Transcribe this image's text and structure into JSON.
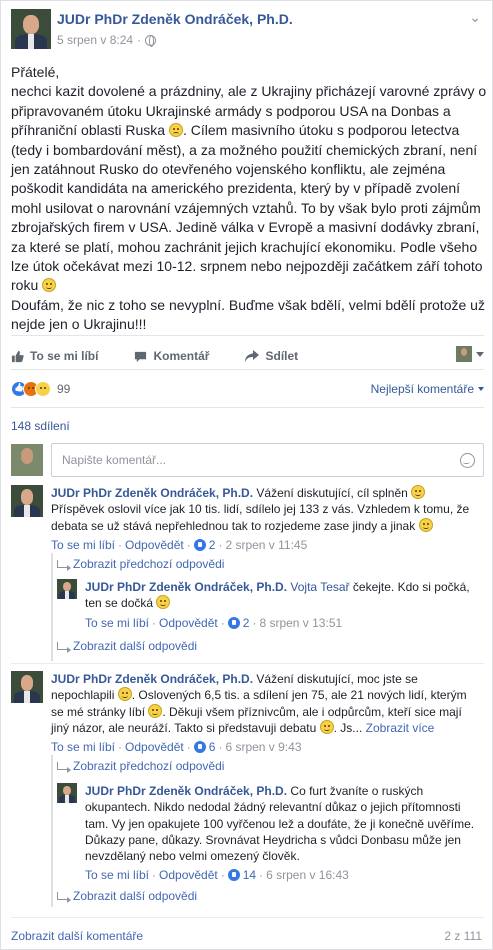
{
  "post": {
    "author": "JUDr PhDr Zdeněk Ondráček, Ph.D.",
    "timestamp": "5 srpen v 8:24",
    "separator": "·",
    "paragraphs": [
      "Přátelé,",
      "nechci kazit dovolené a prázdniny, ale z Ukrajiny přicházejí varovné zprávy o připravovaném útoku Ukrajinské armády s podporou USA na Donbas a příhraniční oblasti Ruska",
      " Cílem masivního útoku s podporou letectva (tedy i bombardování měst), a za možného použití chemických zbraní, není jen zatáhnout Rusko do otevřeného vojenského konfliktu, ale zejména poškodit kandidáta na amerického prezidenta, který by v případě zvolení mohl usilovat o narovnání vzájemných vztahů. To by však bylo proti zájmům zbrojařských firem v USA. Jedině válka v Evropě a masivní dodávky zbraní, za které se platí, mohou zachránit jejich krachující ekonomiku. Podle všeho lze útok očekávat mezi 10-12. srpnem nebo nejpozději začátkem září tohoto roku",
      "Doufám, že nic z toho se nevyplní. Buďme však bdělí, velmi bdělí protože už nejde jen o Ukrajinu!!!"
    ]
  },
  "actions": {
    "like": "To se mi líbí",
    "comment": "Komentář",
    "share": "Sdílet"
  },
  "reactions": {
    "count": "99",
    "sort_label": "Nejlepší komentáře"
  },
  "shares": "148 sdílení",
  "compose": {
    "placeholder": "Napište komentář..."
  },
  "comments": [
    {
      "author": "JUDr PhDr Zdeněk Ondráček, Ph.D.",
      "text_a": "Vážení diskutující, cíl splněn",
      "text_b": " Příspěvek oslovil více jak 10 tis. lidí, sdílelo jej 133 z vás. Vzhledem k tomu, že debata se už stává nepřehlednou tak to rozjedeme zase jindy a jinak",
      "like": "To se mi líbí",
      "reply": "Odpovědět",
      "likes": "2",
      "time": "2 srpen v 11:45",
      "prev_replies": "Zobrazit předchozí odpovědi",
      "reply_item": {
        "author": "JUDr PhDr Zdeněk Ondráček, Ph.D.",
        "mention": "Vojta Tesař",
        "text": " čekejte. Kdo si počká, ten se dočká",
        "like": "To se mi líbí",
        "reply": "Odpovědět",
        "likes": "2",
        "time": "8 srpen v 13:51"
      },
      "more_replies": "Zobrazit další odpovědi"
    },
    {
      "author": "JUDr PhDr Zdeněk Ondráček, Ph.D.",
      "text_a": "Vážení diskutující, moc jste se nepochlapili",
      "text_b": ". Oslovených 6,5 tis. a sdílení jen 75, ale 21 nových lidí, kterým se mé stránky líbí",
      "text_c": ". Děkuji všem příznivcům, ale i odpůrcům, kteří sice mají jiný názor, ale neuráží. Takto si představuji debatu",
      "text_d": ". Js...",
      "see_more": "Zobrazit více",
      "like": "To se mi líbí",
      "reply": "Odpovědět",
      "likes": "6",
      "time": "6 srpen v 9:43",
      "prev_replies": "Zobrazit předchozí odpovědi",
      "reply_item": {
        "author": "JUDr PhDr Zdeněk Ondráček, Ph.D.",
        "text": " Co furt žvaníte o ruských okupantech. Nikdo nedodal žádný relevantní důkaz o jejich přítomnosti tam. Vy jen opakujete 100 vyřčenou lež a doufáte, že ji konečně uvěříme. Důkazy pane, důkazy. Srovnávat Heydricha s vůdci Donbasu může jen nevzdělaný nebo velmi omezený člověk.",
        "like": "To se mi líbí",
        "reply": "Odpovědět",
        "likes": "14",
        "time": "6 srpen v 16:43"
      },
      "more_replies": "Zobrazit další odpovědi"
    }
  ],
  "footer": {
    "more_comments": "Zobrazit další komentáře",
    "count": "2 z 111"
  }
}
